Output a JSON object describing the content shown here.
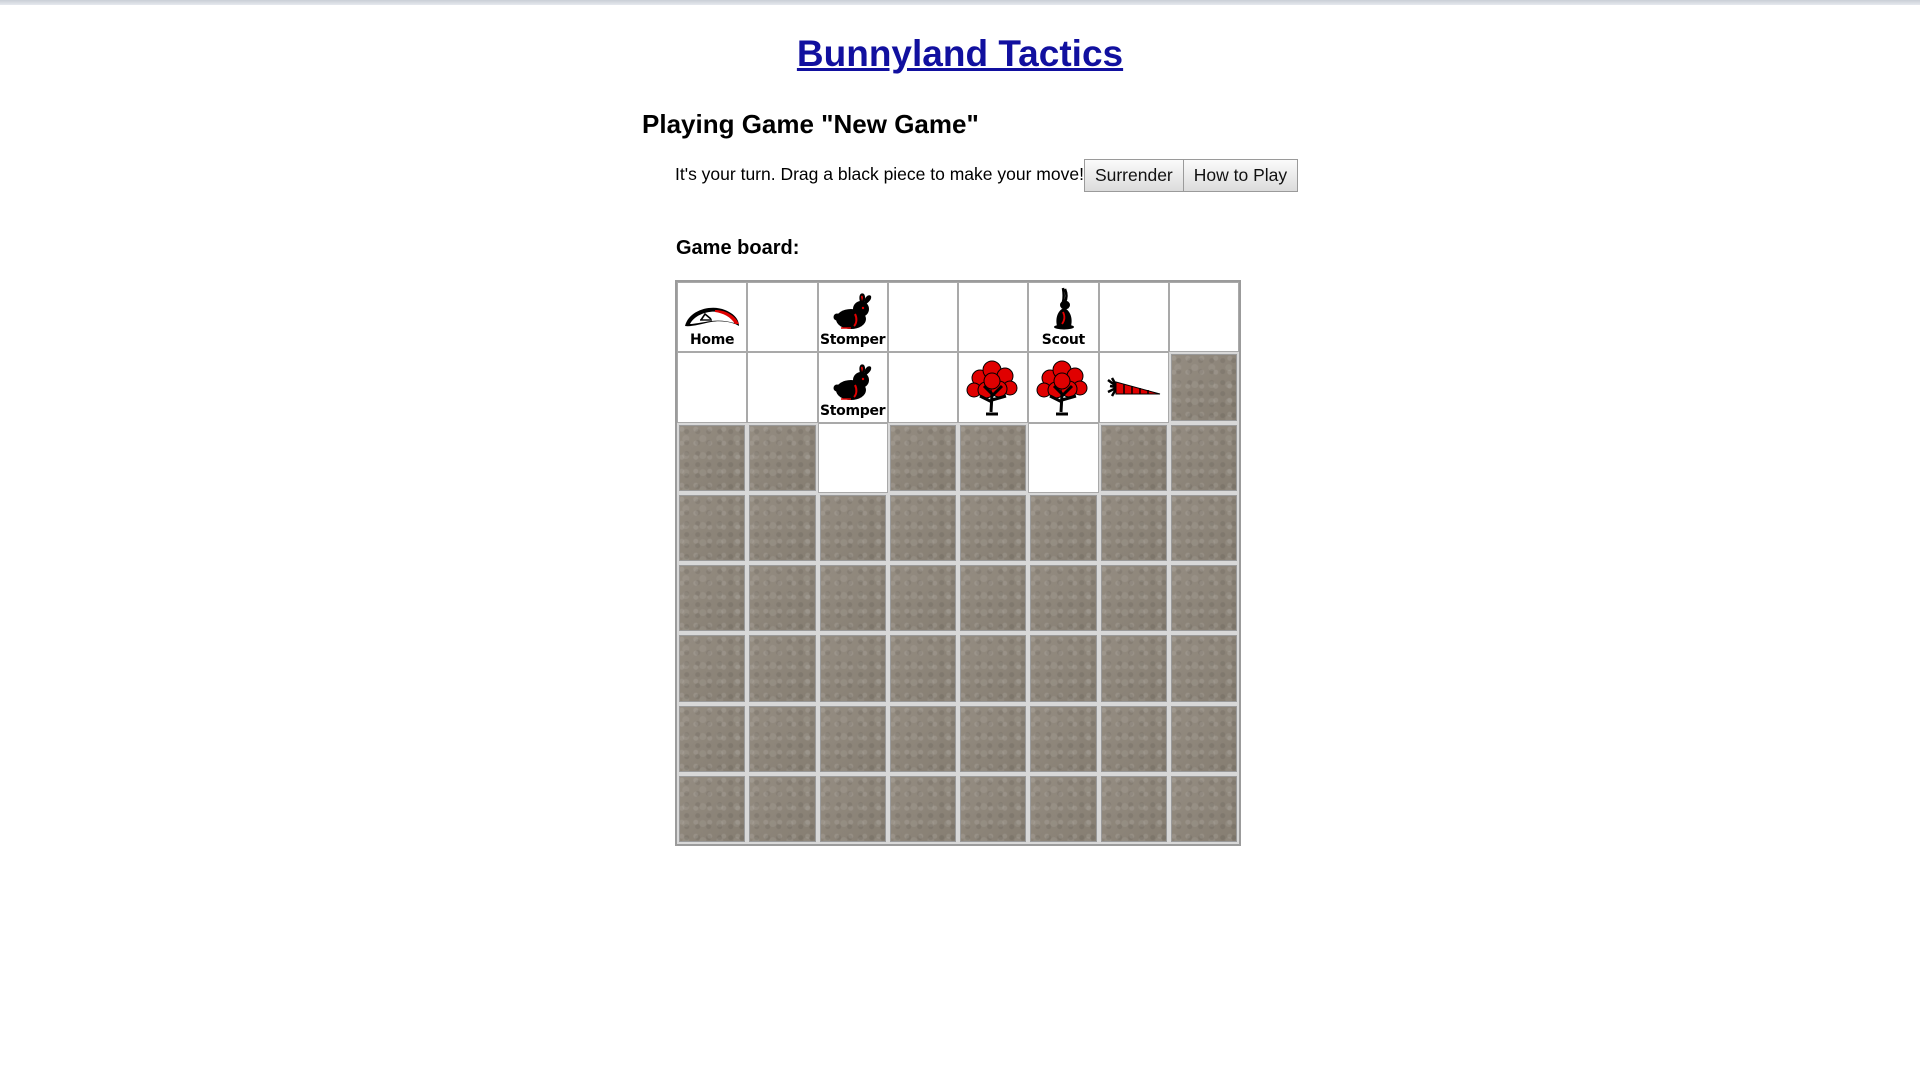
{
  "site": {
    "title": "Bunnyland Tactics"
  },
  "game": {
    "heading": "Playing Game \"New Game\"",
    "turn_message": "It's your turn. Drag a black piece to make your move!",
    "buttons": {
      "surrender": "Surrender",
      "how_to_play": "How to Play"
    },
    "board_label": "Game board:"
  },
  "board": {
    "rows": 8,
    "cols": 8,
    "cells": [
      [
        {
          "type": "home",
          "label": "Home"
        },
        {
          "type": "empty"
        },
        {
          "type": "stomper",
          "label": "Stomper"
        },
        {
          "type": "empty"
        },
        {
          "type": "empty"
        },
        {
          "type": "scout",
          "label": "Scout"
        },
        {
          "type": "empty"
        },
        {
          "type": "empty"
        }
      ],
      [
        {
          "type": "empty"
        },
        {
          "type": "empty"
        },
        {
          "type": "stomper",
          "label": "Stomper"
        },
        {
          "type": "empty"
        },
        {
          "type": "tree"
        },
        {
          "type": "tree"
        },
        {
          "type": "carrot"
        },
        {
          "type": "fog"
        }
      ],
      [
        {
          "type": "fog"
        },
        {
          "type": "fog"
        },
        {
          "type": "empty"
        },
        {
          "type": "fog"
        },
        {
          "type": "fog"
        },
        {
          "type": "empty"
        },
        {
          "type": "fog"
        },
        {
          "type": "fog"
        }
      ],
      [
        {
          "type": "fog"
        },
        {
          "type": "fog"
        },
        {
          "type": "fog"
        },
        {
          "type": "fog"
        },
        {
          "type": "fog"
        },
        {
          "type": "fog"
        },
        {
          "type": "fog"
        },
        {
          "type": "fog"
        }
      ],
      [
        {
          "type": "fog"
        },
        {
          "type": "fog"
        },
        {
          "type": "fog"
        },
        {
          "type": "fog"
        },
        {
          "type": "fog"
        },
        {
          "type": "fog"
        },
        {
          "type": "fog"
        },
        {
          "type": "fog"
        }
      ],
      [
        {
          "type": "fog"
        },
        {
          "type": "fog"
        },
        {
          "type": "fog"
        },
        {
          "type": "fog"
        },
        {
          "type": "fog"
        },
        {
          "type": "fog"
        },
        {
          "type": "fog"
        },
        {
          "type": "fog"
        }
      ],
      [
        {
          "type": "fog"
        },
        {
          "type": "fog"
        },
        {
          "type": "fog"
        },
        {
          "type": "fog"
        },
        {
          "type": "fog"
        },
        {
          "type": "fog"
        },
        {
          "type": "fog"
        },
        {
          "type": "fog"
        }
      ],
      [
        {
          "type": "fog"
        },
        {
          "type": "fog"
        },
        {
          "type": "fog"
        },
        {
          "type": "fog"
        },
        {
          "type": "fog"
        },
        {
          "type": "fog"
        },
        {
          "type": "fog"
        },
        {
          "type": "fog"
        }
      ]
    ]
  },
  "icons": {
    "home": "home-burrow-icon",
    "stomper": "stomper-bunny-icon",
    "scout": "scout-bunny-icon",
    "tree": "tree-icon",
    "carrot": "carrot-icon"
  },
  "colors": {
    "link": "#11109f",
    "piece_black": "#000000",
    "piece_red": "#e00000",
    "fog": "#8c8478",
    "grid": "#a9a9a9"
  }
}
